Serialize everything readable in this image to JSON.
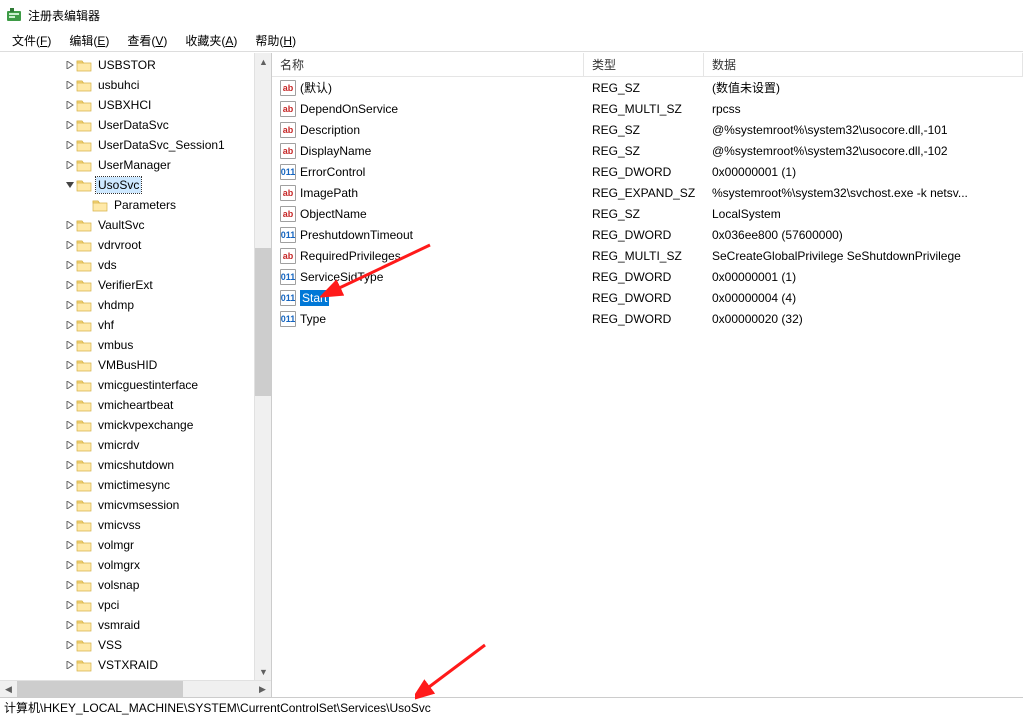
{
  "window": {
    "title": "注册表编辑器"
  },
  "menubar": [
    {
      "label": "文件",
      "hotkey": "F"
    },
    {
      "label": "编辑",
      "hotkey": "E"
    },
    {
      "label": "查看",
      "hotkey": "V"
    },
    {
      "label": "收藏夹",
      "hotkey": "A"
    },
    {
      "label": "帮助",
      "hotkey": "H"
    }
  ],
  "tree": {
    "selected": "UsoSvc",
    "items": [
      {
        "label": "USBSTOR",
        "depth": 4,
        "twisty": ">"
      },
      {
        "label": "usbuhci",
        "depth": 4,
        "twisty": ">"
      },
      {
        "label": "USBXHCI",
        "depth": 4,
        "twisty": ">"
      },
      {
        "label": "UserDataSvc",
        "depth": 4,
        "twisty": ">"
      },
      {
        "label": "UserDataSvc_Session1",
        "depth": 4,
        "twisty": ">"
      },
      {
        "label": "UserManager",
        "depth": 4,
        "twisty": ">"
      },
      {
        "label": "UsoSvc",
        "depth": 4,
        "twisty": "v",
        "selected": true
      },
      {
        "label": "Parameters",
        "depth": 5,
        "twisty": ""
      },
      {
        "label": "VaultSvc",
        "depth": 4,
        "twisty": ">"
      },
      {
        "label": "vdrvroot",
        "depth": 4,
        "twisty": ">"
      },
      {
        "label": "vds",
        "depth": 4,
        "twisty": ">"
      },
      {
        "label": "VerifierExt",
        "depth": 4,
        "twisty": ">"
      },
      {
        "label": "vhdmp",
        "depth": 4,
        "twisty": ">"
      },
      {
        "label": "vhf",
        "depth": 4,
        "twisty": ">"
      },
      {
        "label": "vmbus",
        "depth": 4,
        "twisty": ">"
      },
      {
        "label": "VMBusHID",
        "depth": 4,
        "twisty": ">"
      },
      {
        "label": "vmicguestinterface",
        "depth": 4,
        "twisty": ">"
      },
      {
        "label": "vmicheartbeat",
        "depth": 4,
        "twisty": ">"
      },
      {
        "label": "vmickvpexchange",
        "depth": 4,
        "twisty": ">"
      },
      {
        "label": "vmicrdv",
        "depth": 4,
        "twisty": ">"
      },
      {
        "label": "vmicshutdown",
        "depth": 4,
        "twisty": ">"
      },
      {
        "label": "vmictimesync",
        "depth": 4,
        "twisty": ">"
      },
      {
        "label": "vmicvmsession",
        "depth": 4,
        "twisty": ">"
      },
      {
        "label": "vmicvss",
        "depth": 4,
        "twisty": ">"
      },
      {
        "label": "volmgr",
        "depth": 4,
        "twisty": ">"
      },
      {
        "label": "volmgrx",
        "depth": 4,
        "twisty": ">"
      },
      {
        "label": "volsnap",
        "depth": 4,
        "twisty": ">"
      },
      {
        "label": "vpci",
        "depth": 4,
        "twisty": ">"
      },
      {
        "label": "vsmraid",
        "depth": 4,
        "twisty": ">"
      },
      {
        "label": "VSS",
        "depth": 4,
        "twisty": ">"
      },
      {
        "label": "VSTXRAID",
        "depth": 4,
        "twisty": ">"
      }
    ]
  },
  "values": {
    "columns": {
      "name": "名称",
      "type": "类型",
      "data": "数据"
    },
    "rows": [
      {
        "icon": "str",
        "name": "(默认)",
        "type": "REG_SZ",
        "data": "(数值未设置)"
      },
      {
        "icon": "str",
        "name": "DependOnService",
        "type": "REG_MULTI_SZ",
        "data": "rpcss"
      },
      {
        "icon": "str",
        "name": "Description",
        "type": "REG_SZ",
        "data": "@%systemroot%\\system32\\usocore.dll,-101"
      },
      {
        "icon": "str",
        "name": "DisplayName",
        "type": "REG_SZ",
        "data": "@%systemroot%\\system32\\usocore.dll,-102"
      },
      {
        "icon": "bin",
        "name": "ErrorControl",
        "type": "REG_DWORD",
        "data": "0x00000001 (1)"
      },
      {
        "icon": "str",
        "name": "ImagePath",
        "type": "REG_EXPAND_SZ",
        "data": "%systemroot%\\system32\\svchost.exe -k netsv..."
      },
      {
        "icon": "str",
        "name": "ObjectName",
        "type": "REG_SZ",
        "data": "LocalSystem"
      },
      {
        "icon": "bin",
        "name": "PreshutdownTimeout",
        "type": "REG_DWORD",
        "data": "0x036ee800 (57600000)"
      },
      {
        "icon": "str",
        "name": "RequiredPrivileges",
        "type": "REG_MULTI_SZ",
        "data": "SeCreateGlobalPrivilege SeShutdownPrivilege"
      },
      {
        "icon": "bin",
        "name": "ServiceSidType",
        "type": "REG_DWORD",
        "data": "0x00000001 (1)"
      },
      {
        "icon": "bin",
        "name": "Start",
        "type": "REG_DWORD",
        "data": "0x00000004 (4)",
        "selected": true
      },
      {
        "icon": "bin",
        "name": "Type",
        "type": "REG_DWORD",
        "data": "0x00000020 (32)"
      }
    ]
  },
  "statusbar": {
    "path": "计算机\\HKEY_LOCAL_MACHINE\\SYSTEM\\CurrentControlSet\\Services\\UsoSvc"
  },
  "icons": {
    "str_text": "ab",
    "bin_text": "011"
  }
}
